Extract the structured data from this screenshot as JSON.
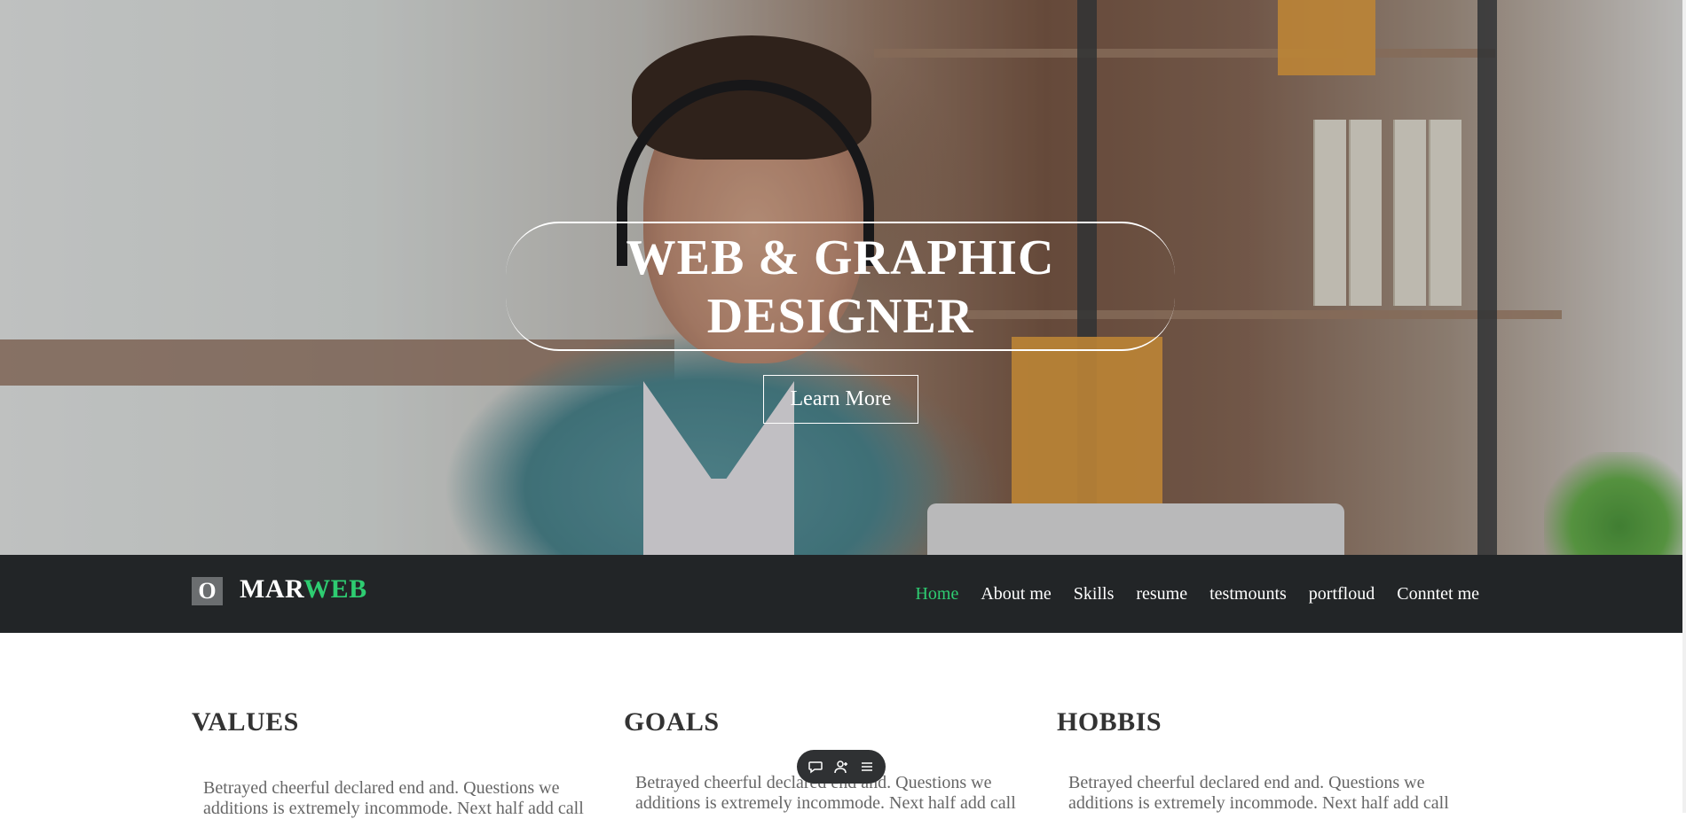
{
  "hero": {
    "headline_line1": "WEB & GRAPHIC",
    "headline_line2": "DESIGNER",
    "cta_label": "Learn More"
  },
  "navbar": {
    "logo_badge": "O",
    "logo_primary": "MAR",
    "logo_accent": "WEB",
    "links": [
      {
        "label": "Home",
        "active": true
      },
      {
        "label": "About me",
        "active": false
      },
      {
        "label": "Skills",
        "active": false
      },
      {
        "label": "resume",
        "active": false
      },
      {
        "label": "testmounts",
        "active": false
      },
      {
        "label": "portfloud",
        "active": false
      },
      {
        "label": "Conntet me",
        "active": false
      }
    ]
  },
  "sections": [
    {
      "title": "VALUES",
      "text": "Betrayed cheerful declared end and. Questions we additions is extremely incommode. Next half add call"
    },
    {
      "title": "GOALS",
      "text": "Betrayed cheerful declared end and. Questions we additions is extremely incommode. Next half add call"
    },
    {
      "title": "HOBBIS",
      "text": "Betrayed cheerful declared end and. Questions we additions is extremely incommode. Next half add call"
    }
  ],
  "floating_toolbar": {
    "icons": [
      "chat-icon",
      "add-user-icon",
      "menu-icon"
    ]
  },
  "colors": {
    "accent": "#2ecc71",
    "navbar_bg": "#222527",
    "heading": "#333333",
    "body_text": "#666666"
  }
}
